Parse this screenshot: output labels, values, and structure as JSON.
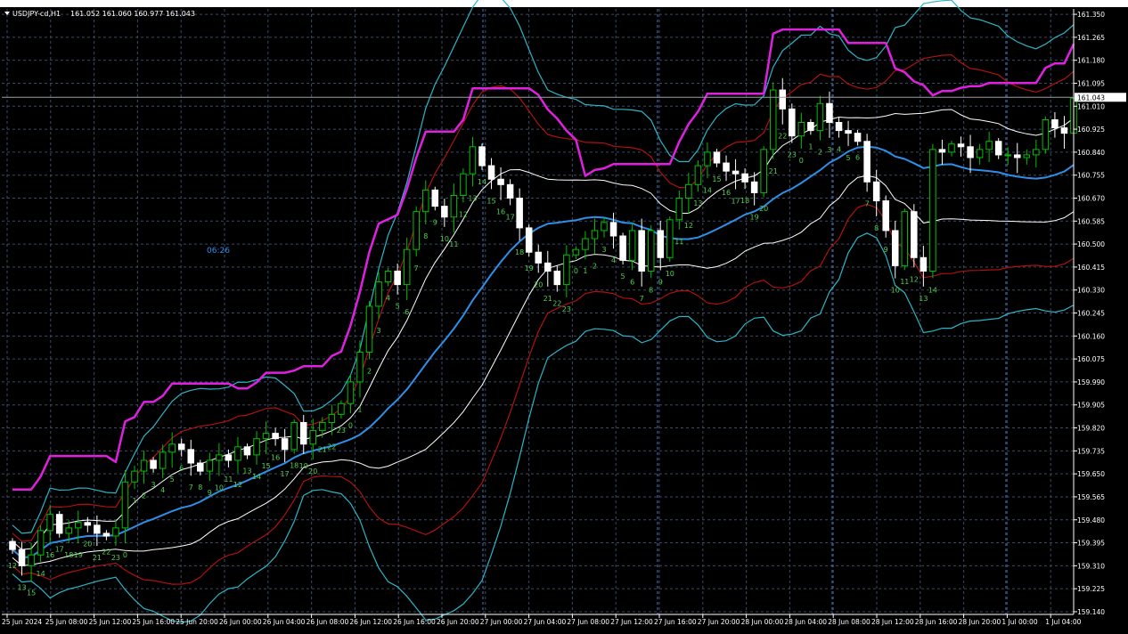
{
  "header": {
    "symbol": "USDJPY-cd,H1",
    "ohlc": "161.052 161.060 160.977 161.043",
    "timer": "06:26"
  },
  "colors": {
    "background": "#000000",
    "grid": "#3b4a68",
    "axis": "#ffffff",
    "bull": "#00c000",
    "bear": "#ffffff",
    "ma": "#2e8fe8",
    "bb1": "#ffffff",
    "bb2": "#b01010",
    "bb3": "#2ab6c8",
    "indicator": "#e020e0",
    "counter": "#4fd050",
    "timer": "#2e8fe8"
  },
  "chart_data": {
    "type": "candlestick",
    "title": "USDJPY-cd,H1",
    "last_price": "161.043",
    "y_ticks": [
      "161.350",
      "161.265",
      "161.180",
      "161.095",
      "161.010",
      "160.925",
      "160.840",
      "160.755",
      "160.670",
      "160.585",
      "160.500",
      "160.415",
      "160.330",
      "160.245",
      "160.160",
      "160.075",
      "159.990",
      "159.905",
      "159.820",
      "159.735",
      "159.650",
      "159.565",
      "159.480",
      "159.395",
      "159.310",
      "159.225",
      "159.140"
    ],
    "ylim": [
      159.13,
      161.37
    ],
    "x_labels": [
      "25 Jun 2024",
      "25 Jun 08:00",
      "25 Jun 12:00",
      "25 Jun 16:00",
      "25 Jun 20:00",
      "26 Jun 00:00",
      "26 Jun 04:00",
      "26 Jun 08:00",
      "26 Jun 12:00",
      "26 Jun 16:00",
      "26 Jun 20:00",
      "27 Jun 00:00",
      "27 Jun 04:00",
      "27 Jun 08:00",
      "27 Jun 12:00",
      "27 Jun 16:00",
      "27 Jun 20:00",
      "28 Jun 00:00",
      "28 Jun 04:00",
      "28 Jun 08:00",
      "28 Jun 12:00",
      "28 Jun 16:00",
      "28 Jun 20:00",
      "1 Jul 00:00",
      "1 Jul 04:00"
    ],
    "close": [
      159.37,
      159.31,
      159.35,
      159.44,
      159.5,
      159.43,
      159.45,
      159.47,
      159.46,
      159.43,
      159.42,
      159.45,
      159.62,
      159.66,
      159.7,
      159.67,
      159.73,
      159.76,
      159.74,
      159.69,
      159.66,
      159.7,
      159.72,
      159.7,
      159.75,
      159.72,
      159.78,
      159.8,
      159.78,
      159.74,
      159.84,
      159.76,
      159.81,
      159.84,
      159.87,
      159.91,
      159.99,
      160.1,
      160.27,
      160.36,
      160.4,
      160.35,
      160.48,
      160.62,
      160.7,
      160.64,
      160.6,
      160.68,
      160.76,
      160.86,
      160.79,
      160.74,
      160.72,
      160.67,
      160.56,
      160.47,
      160.43,
      160.4,
      160.35,
      160.46,
      160.48,
      160.52,
      160.55,
      160.58,
      160.53,
      160.44,
      160.55,
      160.4,
      160.55,
      160.45,
      160.59,
      160.67,
      160.72,
      160.79,
      160.84,
      160.8,
      160.77,
      160.76,
      160.73,
      160.69,
      160.85,
      161.07,
      161.0,
      160.9,
      160.95,
      160.92,
      161.02,
      160.95,
      160.92,
      160.91,
      160.88,
      160.73,
      160.66,
      160.55,
      160.42,
      160.62,
      160.45,
      160.4,
      160.85,
      160.84,
      160.87,
      160.86,
      160.82,
      160.85,
      160.88,
      160.83,
      160.83,
      160.82,
      160.83,
      160.85,
      160.96,
      160.93,
      160.91,
      161.04
    ],
    "counters": [
      "12",
      "13",
      "15",
      "14",
      "16",
      "17",
      "18",
      "19",
      "20",
      "21",
      "22",
      "23",
      "0",
      "1",
      "2",
      "3",
      "4",
      "5",
      "6",
      "7",
      "8",
      "9",
      "10",
      "11",
      "12",
      "13",
      "14",
      "15",
      "16",
      "17",
      "18",
      "19",
      "20",
      "21",
      "22",
      "23",
      "0",
      "1",
      "2",
      "3",
      "4",
      "5",
      "6",
      "7",
      "8",
      "9",
      "10",
      "11",
      "12",
      "13",
      "14",
      "15",
      "16",
      "17",
      "18",
      "19",
      "20",
      "21",
      "22",
      "23",
      "0",
      "1",
      "2",
      "3",
      "4",
      "5",
      "6",
      "7",
      "8",
      "9",
      "10",
      "11",
      "12",
      "13",
      "14",
      "15",
      "16",
      "17",
      "18",
      "19",
      "20",
      "21",
      "22",
      "23",
      "0",
      "1",
      "2",
      "3",
      "4",
      "5",
      "6",
      "7",
      "8",
      "9",
      "10",
      "11",
      "12",
      "13",
      "14"
    ]
  }
}
